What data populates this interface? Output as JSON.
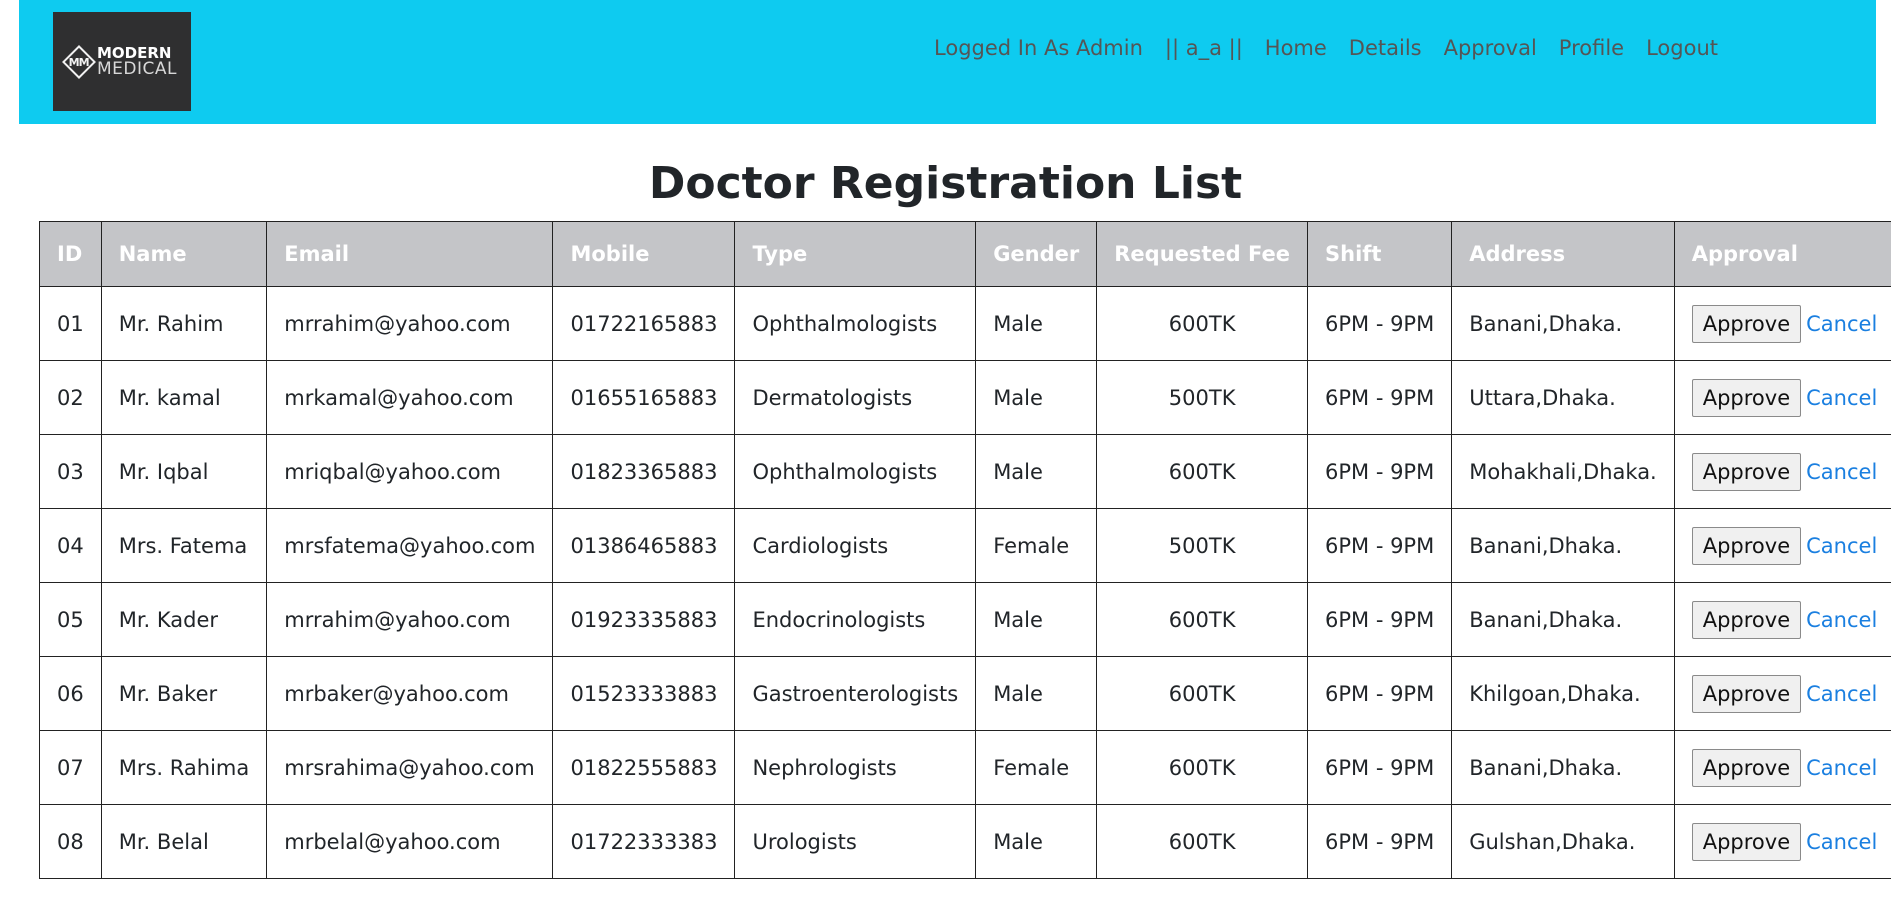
{
  "header": {
    "logo": {
      "line1": "MODERN",
      "line2": "MEDICAL",
      "mark": "MM"
    },
    "nav": {
      "logged_in": "Logged In As Admin",
      "user": "|| a_a ||",
      "home": "Home",
      "details": "Details",
      "approval": "Approval",
      "profile": "Profile",
      "logout": "Logout"
    }
  },
  "page_title": "Doctor Registration List",
  "table": {
    "columns": [
      "ID",
      "Name",
      "Email",
      "Mobile",
      "Type",
      "Gender",
      "Requested Fee",
      "Shift",
      "Address",
      "Approval"
    ],
    "approve_label": "Approve",
    "cancel_label": "Cancel",
    "rows": [
      {
        "id": "01",
        "name": "Mr. Rahim",
        "email": "mrrahim@yahoo.com",
        "mobile": "01722165883",
        "type": "Ophthalmologists",
        "gender": "Male",
        "fee": "600TK",
        "shift": "6PM - 9PM",
        "address": "Banani,Dhaka."
      },
      {
        "id": "02",
        "name": "Mr. kamal",
        "email": "mrkamal@yahoo.com",
        "mobile": "01655165883",
        "type": "Dermatologists",
        "gender": "Male",
        "fee": "500TK",
        "shift": "6PM - 9PM",
        "address": "Uttara,Dhaka."
      },
      {
        "id": "03",
        "name": "Mr. Iqbal",
        "email": "mriqbal@yahoo.com",
        "mobile": "01823365883",
        "type": "Ophthalmologists",
        "gender": "Male",
        "fee": "600TK",
        "shift": "6PM - 9PM",
        "address": "Mohakhali,Dhaka."
      },
      {
        "id": "04",
        "name": "Mrs. Fatema",
        "email": "mrsfatema@yahoo.com",
        "mobile": "01386465883",
        "type": "Cardiologists",
        "gender": "Female",
        "fee": "500TK",
        "shift": "6PM - 9PM",
        "address": "Banani,Dhaka."
      },
      {
        "id": "05",
        "name": "Mr. Kader",
        "email": "mrrahim@yahoo.com",
        "mobile": "01923335883",
        "type": "Endocrinologists",
        "gender": "Male",
        "fee": "600TK",
        "shift": "6PM - 9PM",
        "address": "Banani,Dhaka."
      },
      {
        "id": "06",
        "name": "Mr. Baker",
        "email": "mrbaker@yahoo.com",
        "mobile": "01523333883",
        "type": "Gastroenterologists",
        "gender": "Male",
        "fee": "600TK",
        "shift": "6PM - 9PM",
        "address": "Khilgoan,Dhaka."
      },
      {
        "id": "07",
        "name": "Mrs. Rahima",
        "email": "mrsrahima@yahoo.com",
        "mobile": "01822555883",
        "type": "Nephrologists",
        "gender": "Female",
        "fee": "600TK",
        "shift": "6PM - 9PM",
        "address": "Banani,Dhaka."
      },
      {
        "id": "08",
        "name": "Mr. Belal",
        "email": "mrbelal@yahoo.com",
        "mobile": "01722333383",
        "type": "Urologists",
        "gender": "Male",
        "fee": "600TK",
        "shift": "6PM - 9PM",
        "address": "Gulshan,Dhaka."
      }
    ]
  }
}
